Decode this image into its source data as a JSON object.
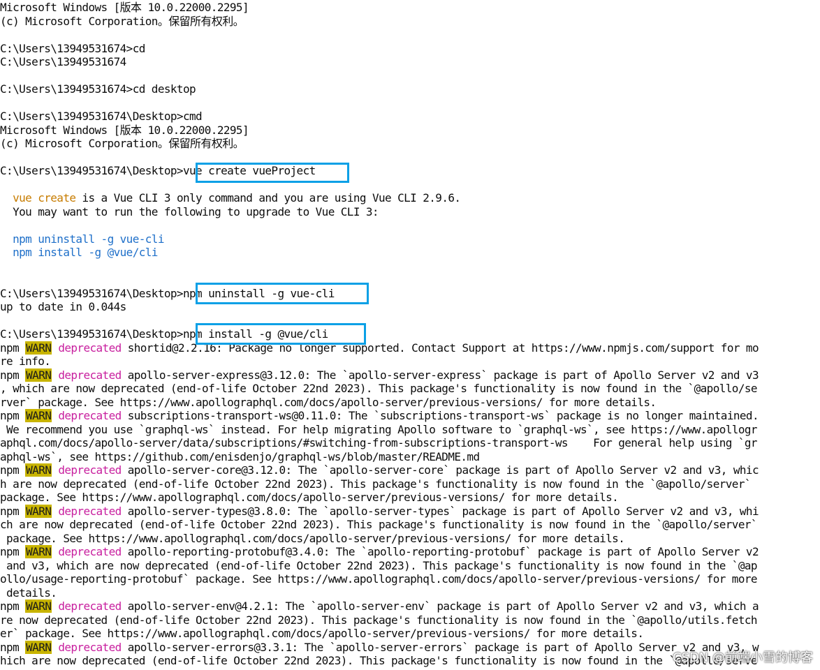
{
  "terminal": {
    "lines": [
      [
        {
          "t": "Microsoft Windows [版本 10.0.22000.2295]"
        }
      ],
      [
        {
          "t": "(c) Microsoft Corporation。保留所有权利。"
        }
      ],
      [],
      [
        {
          "t": "C:\\Users\\13949531674>cd"
        }
      ],
      [
        {
          "t": "C:\\Users\\13949531674"
        }
      ],
      [],
      [
        {
          "t": "C:\\Users\\13949531674>cd desktop"
        }
      ],
      [],
      [
        {
          "t": "C:\\Users\\13949531674\\Desktop>cmd"
        }
      ],
      [
        {
          "t": "Microsoft Windows [版本 10.0.22000.2295]"
        }
      ],
      [
        {
          "t": "(c) Microsoft Corporation。保留所有权利。"
        }
      ],
      [],
      [
        {
          "t": "C:\\Users\\13949531674\\Desktop>vue create vueProject"
        }
      ],
      [],
      [
        {
          "t": "  "
        },
        {
          "t": "vue create",
          "c": "org"
        },
        {
          "t": " is a Vue CLI 3 only command and you are using Vue CLI 2.9.6."
        }
      ],
      [
        {
          "t": "  You may want to run the following to upgrade to Vue CLI 3:"
        }
      ],
      [],
      [
        {
          "t": "  "
        },
        {
          "t": "npm uninstall -g vue-cli",
          "c": "hl"
        }
      ],
      [
        {
          "t": "  "
        },
        {
          "t": "npm install -g @vue/cli",
          "c": "hl"
        }
      ],
      [],
      [],
      [
        {
          "t": "C:\\Users\\13949531674\\Desktop>npm uninstall -g vue-cli"
        }
      ],
      [
        {
          "t": "up to date in 0.044s"
        }
      ],
      [],
      [
        {
          "t": "C:\\Users\\13949531674\\Desktop>npm install -g @vue/cli"
        }
      ],
      [
        {
          "t": "npm "
        },
        {
          "t": "WARN",
          "c": "warn"
        },
        {
          "t": " "
        },
        {
          "t": "deprecated",
          "c": "dep"
        },
        {
          "t": " shortid@2.2.16: Package no longer supported. Contact Support at https://www.npmjs.com/support for mo"
        }
      ],
      [
        {
          "t": "re info."
        }
      ],
      [
        {
          "t": "npm "
        },
        {
          "t": "WARN",
          "c": "warn"
        },
        {
          "t": " "
        },
        {
          "t": "deprecated",
          "c": "dep"
        },
        {
          "t": " apollo-server-express@3.12.0: The `apollo-server-express` package is part of Apollo Server v2 and v3"
        }
      ],
      [
        {
          "t": ", which are now deprecated (end-of-life October 22nd 2023). This package's functionality is now found in the `@apollo/se"
        }
      ],
      [
        {
          "t": "rver` package. See https://www.apollographql.com/docs/apollo-server/previous-versions/ for more details."
        }
      ],
      [
        {
          "t": "npm "
        },
        {
          "t": "WARN",
          "c": "warn"
        },
        {
          "t": " "
        },
        {
          "t": "deprecated",
          "c": "dep"
        },
        {
          "t": " subscriptions-transport-ws@0.11.0: The `subscriptions-transport-ws` package is no longer maintained."
        }
      ],
      [
        {
          "t": " We recommend you use `graphql-ws` instead. For help migrating Apollo software to `graphql-ws`, see https://www.apollogr"
        }
      ],
      [
        {
          "t": "aphql.com/docs/apollo-server/data/subscriptions/#switching-from-subscriptions-transport-ws    For general help using `gr"
        }
      ],
      [
        {
          "t": "aphql-ws`, see https://github.com/enisdenjo/graphql-ws/blob/master/README.md"
        }
      ],
      [
        {
          "t": "npm "
        },
        {
          "t": "WARN",
          "c": "warn"
        },
        {
          "t": " "
        },
        {
          "t": "deprecated",
          "c": "dep"
        },
        {
          "t": " apollo-server-core@3.12.0: The `apollo-server-core` package is part of Apollo Server v2 and v3, whic"
        }
      ],
      [
        {
          "t": "h are now deprecated (end-of-life October 22nd 2023). This package's functionality is now found in the `@apollo/server`"
        }
      ],
      [
        {
          "t": "package. See https://www.apollographql.com/docs/apollo-server/previous-versions/ for more details."
        }
      ],
      [
        {
          "t": "npm "
        },
        {
          "t": "WARN",
          "c": "warn"
        },
        {
          "t": " "
        },
        {
          "t": "deprecated",
          "c": "dep"
        },
        {
          "t": " apollo-server-types@3.8.0: The `apollo-server-types` package is part of Apollo Server v2 and v3, whi"
        }
      ],
      [
        {
          "t": "ch are now deprecated (end-of-life October 22nd 2023). This package's functionality is now found in the `@apollo/server`"
        }
      ],
      [
        {
          "t": " package. See https://www.apollographql.com/docs/apollo-server/previous-versions/ for more details."
        }
      ],
      [
        {
          "t": "npm "
        },
        {
          "t": "WARN",
          "c": "warn"
        },
        {
          "t": " "
        },
        {
          "t": "deprecated",
          "c": "dep"
        },
        {
          "t": " apollo-reporting-protobuf@3.4.0: The `apollo-reporting-protobuf` package is part of Apollo Server v2"
        }
      ],
      [
        {
          "t": " and v3, which are now deprecated (end-of-life October 22nd 2023). This package's functionality is now found in the `@ap"
        }
      ],
      [
        {
          "t": "ollo/usage-reporting-protobuf` package. See https://www.apollographql.com/docs/apollo-server/previous-versions/ for more"
        }
      ],
      [
        {
          "t": " details."
        }
      ],
      [
        {
          "t": "npm "
        },
        {
          "t": "WARN",
          "c": "warn"
        },
        {
          "t": " "
        },
        {
          "t": "deprecated",
          "c": "dep"
        },
        {
          "t": " apollo-server-env@4.2.1: The `apollo-server-env` package is part of Apollo Server v2 and v3, which a"
        }
      ],
      [
        {
          "t": "re now deprecated (end-of-life October 22nd 2023). This package's functionality is now found in the `@apollo/utils.fetch"
        }
      ],
      [
        {
          "t": "er` package. See https://www.apollographql.com/docs/apollo-server/previous-versions/ for more details."
        }
      ],
      [
        {
          "t": "npm "
        },
        {
          "t": "WARN",
          "c": "warn"
        },
        {
          "t": " "
        },
        {
          "t": "deprecated",
          "c": "dep"
        },
        {
          "t": " apollo-server-errors@3.3.1: The `apollo-server-errors` package is part of Apollo Server v2 and v3, w"
        }
      ],
      [
        {
          "t": "hich are now deprecated (end-of-life October 22nd 2023). This package's functionality is now found in the `@apollo/serve"
        }
      ]
    ]
  },
  "highlights": {
    "colors": {
      "box": "#0aa0e6",
      "warn_bg": "#c8b400",
      "deprecated": "#c81e9e",
      "hint": "#1e6fc9",
      "command": "#c77c00"
    }
  },
  "watermark": "CSDN @前端小雪的博客"
}
